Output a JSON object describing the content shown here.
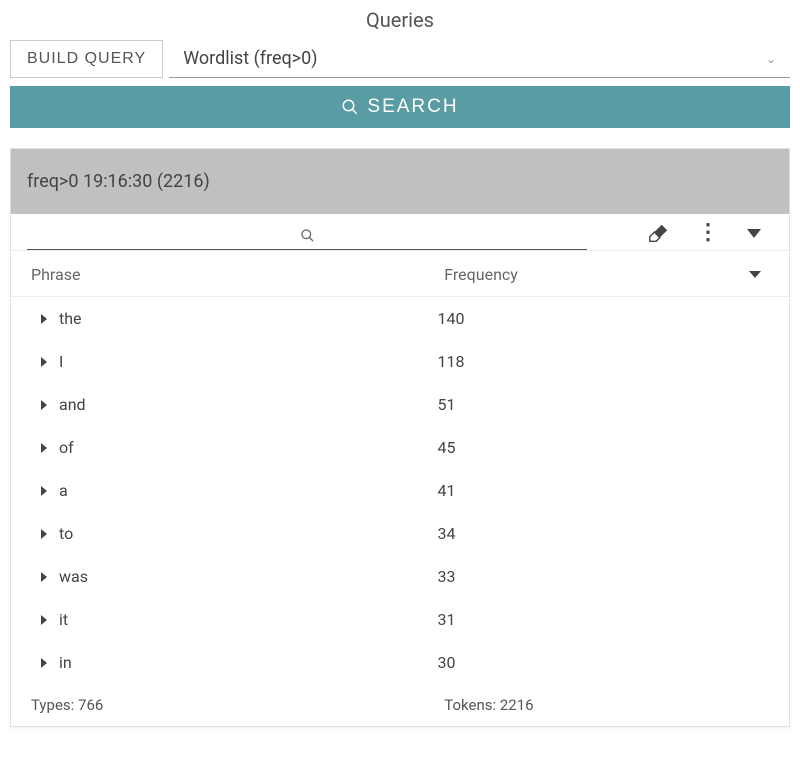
{
  "title": "Queries",
  "buildQuery": {
    "label": "BUILD QUERY"
  },
  "querySelect": {
    "value": "Wordlist (freq>0)"
  },
  "searchBtn": {
    "label": "SEARCH"
  },
  "resultHeader": "freq>0 19:16:30 (2216)",
  "filter": {
    "placeholder": ""
  },
  "columns": {
    "phrase": "Phrase",
    "frequency": "Frequency"
  },
  "rows": [
    {
      "phrase": "the",
      "frequency": 140
    },
    {
      "phrase": "I",
      "frequency": 118
    },
    {
      "phrase": "and",
      "frequency": 51
    },
    {
      "phrase": "of",
      "frequency": 45
    },
    {
      "phrase": "a",
      "frequency": 41
    },
    {
      "phrase": "to",
      "frequency": 34
    },
    {
      "phrase": "was",
      "frequency": 33
    },
    {
      "phrase": "it",
      "frequency": 31
    },
    {
      "phrase": "in",
      "frequency": 30
    }
  ],
  "footer": {
    "typesLabel": "Types:",
    "typesValue": 766,
    "tokensLabel": "Tokens:",
    "tokensValue": 2216
  }
}
